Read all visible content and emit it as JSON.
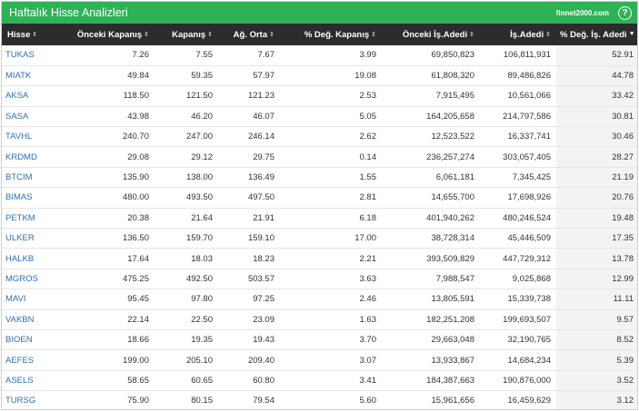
{
  "header": {
    "title": "Haftalık Hisse Analizleri",
    "brand": "finnet2000.com",
    "help_label": "?"
  },
  "columns": [
    {
      "label": "Hisse",
      "sort": "⇕"
    },
    {
      "label": "Önceki Kapanış",
      "sort": "⇕"
    },
    {
      "label": "Kapanış",
      "sort": "⇕"
    },
    {
      "label": "Ağ. Orta",
      "sort": "⇕"
    },
    {
      "label": "% Değ. Kapanış",
      "sort": "⇕"
    },
    {
      "label": "Önceki İş.Adedi",
      "sort": "⇕"
    },
    {
      "label": "İş.Adedi",
      "sort": "⇕"
    },
    {
      "label": "% Değ. İş. Adedi",
      "sort": "▼"
    }
  ],
  "rows": [
    [
      "TUKAS",
      "7.26",
      "7.55",
      "7.67",
      "3.99",
      "69,850,823",
      "106,811,931",
      "52.91"
    ],
    [
      "MIATK",
      "49.84",
      "59.35",
      "57.97",
      "19.08",
      "61,808,320",
      "89,486,826",
      "44.78"
    ],
    [
      "AKSA",
      "118.50",
      "121.50",
      "121.23",
      "2.53",
      "7,915,495",
      "10,561,066",
      "33.42"
    ],
    [
      "SASA",
      "43.98",
      "46.20",
      "46.07",
      "5.05",
      "164,205,658",
      "214,797,586",
      "30.81"
    ],
    [
      "TAVHL",
      "240.70",
      "247.00",
      "246.14",
      "2.62",
      "12,523,522",
      "16,337,741",
      "30.46"
    ],
    [
      "KRDMD",
      "29.08",
      "29.12",
      "29.75",
      "0.14",
      "236,257,274",
      "303,057,405",
      "28.27"
    ],
    [
      "BTCIM",
      "135.90",
      "138.00",
      "136.49",
      "1.55",
      "6,061,181",
      "7,345,425",
      "21.19"
    ],
    [
      "BIMAS",
      "480.00",
      "493.50",
      "497.50",
      "2.81",
      "14,655,700",
      "17,698,926",
      "20.76"
    ],
    [
      "PETKM",
      "20.38",
      "21.64",
      "21.91",
      "6.18",
      "401,940,262",
      "480,246,524",
      "19.48"
    ],
    [
      "ULKER",
      "136.50",
      "159.70",
      "159.10",
      "17.00",
      "38,728,314",
      "45,446,509",
      "17.35"
    ],
    [
      "HALKB",
      "17.64",
      "18.03",
      "18.23",
      "2.21",
      "393,509,829",
      "447,729,312",
      "13.78"
    ],
    [
      "MGROS",
      "475.25",
      "492.50",
      "503.57",
      "3.63",
      "7,988,547",
      "9,025,868",
      "12.99"
    ],
    [
      "MAVI",
      "95.45",
      "97.80",
      "97.25",
      "2.46",
      "13,805,591",
      "15,339,738",
      "11.11"
    ],
    [
      "VAKBN",
      "22.14",
      "22.50",
      "23.09",
      "1.63",
      "182,251,208",
      "199,693,507",
      "9.57"
    ],
    [
      "BIOEN",
      "18.66",
      "19.35",
      "19.43",
      "3.70",
      "29,663,048",
      "32,190,765",
      "8.52"
    ],
    [
      "AEFES",
      "199.00",
      "205.10",
      "209.40",
      "3.07",
      "13,933,867",
      "14,684,234",
      "5.39"
    ],
    [
      "ASELS",
      "58.65",
      "60.65",
      "60.80",
      "3.41",
      "184,387,663",
      "190,876,000",
      "3.52"
    ],
    [
      "TURSG",
      "75.90",
      "80.15",
      "79.54",
      "5.60",
      "15,961,656",
      "16,459,629",
      "3.12"
    ]
  ]
}
